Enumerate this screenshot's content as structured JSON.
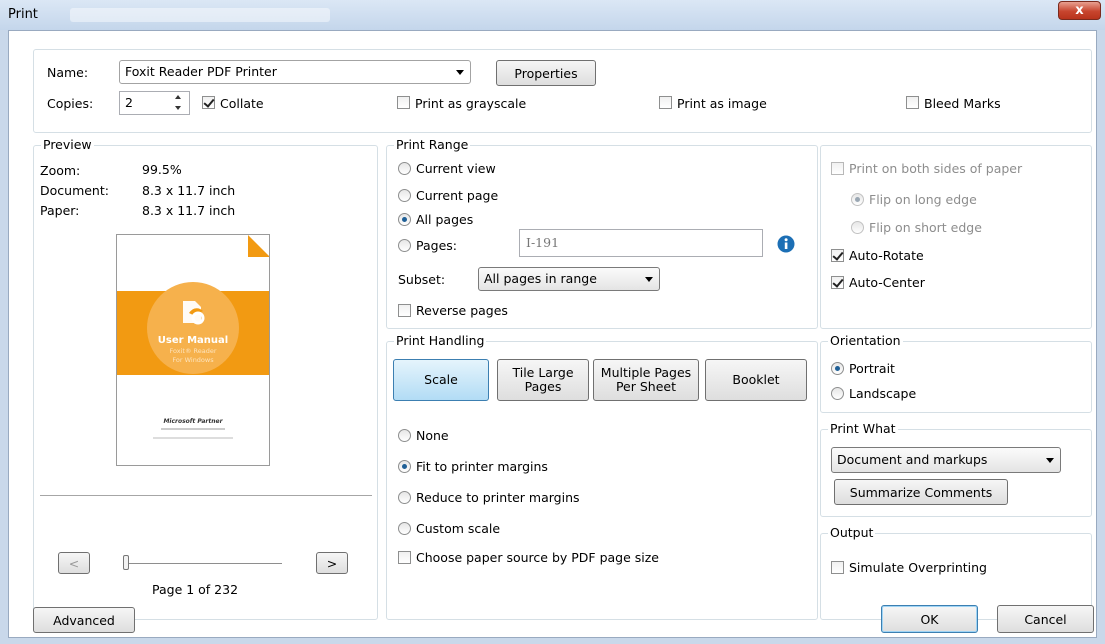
{
  "window": {
    "title": "Print",
    "close_label": "x"
  },
  "printer": {
    "name_label": "Name:",
    "name_value": "Foxit Reader PDF Printer",
    "properties_label": "Properties",
    "copies_label": "Copies:",
    "copies_value": "2",
    "collate_label": "Collate",
    "collate_checked": true,
    "grayscale_label": "Print as grayscale",
    "image_label": "Print as image",
    "bleed_label": "Bleed Marks"
  },
  "preview": {
    "title": "Preview",
    "zoom_label": "Zoom:",
    "zoom_value": "99.5%",
    "document_label": "Document:",
    "document_value": "8.3 x 11.7 inch",
    "paper_label": "Paper:",
    "paper_value": "8.3 x 11.7 inch",
    "thumb_title": "User Manual",
    "thumb_sub1": "Foxit® Reader",
    "thumb_sub2": "For Windows",
    "thumb_partner": "Microsoft Partner",
    "prev_label": "<",
    "next_label": ">",
    "page_indicator": "Page 1 of 232"
  },
  "print_range": {
    "title": "Print Range",
    "current_view": "Current view",
    "current_page": "Current page",
    "all_pages": "All pages",
    "pages_label": "Pages:",
    "pages_placeholder": "I-191",
    "subset_label": "Subset:",
    "subset_value": "All pages in range",
    "reverse_label": "Reverse pages",
    "selected": "all_pages"
  },
  "print_handling": {
    "title": "Print Handling",
    "tabs": [
      "Scale",
      "Tile Large Pages",
      "Multiple Pages Per Sheet",
      "Booklet"
    ],
    "tab_scale": "Scale",
    "tab_tile_1": "Tile Large",
    "tab_tile_2": "Pages",
    "tab_multi_1": "Multiple Pages",
    "tab_multi_2": "Per Sheet",
    "tab_booklet": "Booklet",
    "active_tab": "Scale",
    "none": "None",
    "fit": "Fit to printer margins",
    "reduce": "Reduce to printer margins",
    "custom": "Custom scale",
    "paper_source": "Choose paper source by PDF page size",
    "selected": "fit"
  },
  "duplex": {
    "both_sides": "Print on both sides of paper",
    "long_edge": "Flip on long edge",
    "short_edge": "Flip on short edge",
    "auto_rotate": "Auto-Rotate",
    "auto_center": "Auto-Center"
  },
  "orientation": {
    "title": "Orientation",
    "portrait": "Portrait",
    "landscape": "Landscape",
    "selected": "portrait"
  },
  "print_what": {
    "title": "Print What",
    "value": "Document and markups",
    "summarize_label": "Summarize Comments"
  },
  "output": {
    "title": "Output",
    "simulate_label": "Simulate Overprinting"
  },
  "footer": {
    "advanced_label": "Advanced",
    "ok_label": "OK",
    "cancel_label": "Cancel"
  },
  "colors": {
    "accent_orange": "#f29a12",
    "radio_dot": "#1f5f96",
    "info_blue": "#1c6fb5"
  }
}
